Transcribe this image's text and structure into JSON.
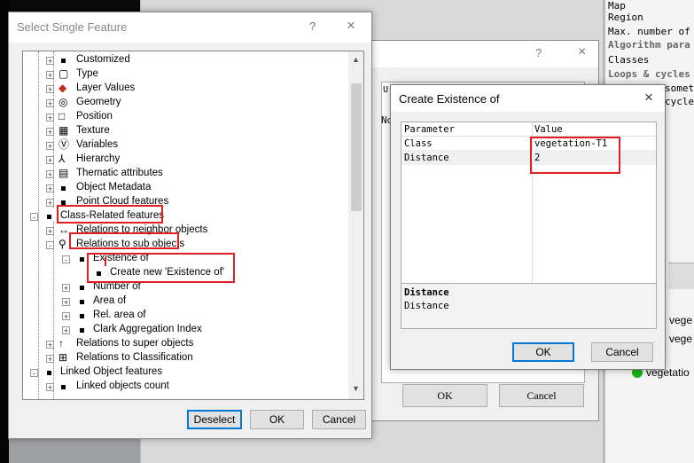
{
  "right_panel": {
    "lines": [
      "Map",
      "Region",
      "Max. number of o",
      "Algorithm para",
      "Classes",
      "Loops & cycles",
      "someti",
      "cycles"
    ],
    "legend": [
      "vege",
      "vege",
      "vegetatio"
    ]
  },
  "bg_window": {
    "help": "?",
    "close": "×",
    "grid_header": "U",
    "grid_cell": "No",
    "ok": "OK",
    "cancel": "Cancel"
  },
  "select_feature": {
    "title": "Select Single Feature",
    "help": "?",
    "close": "×",
    "tree": [
      {
        "label": "Customized",
        "icon": "bullet"
      },
      {
        "label": "Type",
        "icon": "type-icon"
      },
      {
        "label": "Layer Values",
        "icon": "layer-values-icon"
      },
      {
        "label": "Geometry",
        "icon": "geometry-icon"
      },
      {
        "label": "Position",
        "icon": "position-icon"
      },
      {
        "label": "Texture",
        "icon": "texture-icon"
      },
      {
        "label": "Variables",
        "icon": "variables-icon"
      },
      {
        "label": "Hierarchy",
        "icon": "hierarchy-icon"
      },
      {
        "label": "Thematic attributes",
        "icon": "thematic-icon"
      },
      {
        "label": "Object Metadata",
        "icon": "bullet"
      },
      {
        "label": "Point Cloud features",
        "icon": "bullet"
      },
      {
        "label": "Class-Related features",
        "icon": "bullet"
      },
      {
        "label": "Relations to neighbor objects",
        "icon": "neighbor-icon"
      },
      {
        "label": "Relations to sub objects",
        "icon": "sub-objects-icon"
      },
      {
        "label": "Existence of",
        "icon": "bullet"
      },
      {
        "label": "Create new 'Existence of'",
        "icon": "bullet"
      },
      {
        "label": "Number of",
        "icon": "bullet"
      },
      {
        "label": "Area of",
        "icon": "bullet"
      },
      {
        "label": "Rel. area of",
        "icon": "bullet"
      },
      {
        "label": "Clark Aggregation Index",
        "icon": "bullet"
      },
      {
        "label": "Relations to super objects",
        "icon": "super-objects-icon"
      },
      {
        "label": "Relations to Classification",
        "icon": "classification-icon"
      },
      {
        "label": "Linked Object features",
        "icon": "bullet"
      },
      {
        "label": "Linked objects count",
        "icon": "bullet"
      }
    ],
    "deselect": "Deselect",
    "ok": "OK",
    "cancel": "Cancel"
  },
  "create_existence": {
    "title": "Create Existence of",
    "close": "×",
    "headers": [
      "Parameter",
      "Value"
    ],
    "rows": [
      {
        "param": "Class",
        "value": "vegetation-T1"
      },
      {
        "param": "Distance",
        "value": "2"
      }
    ],
    "desc_title": "Distance",
    "desc_text": "Distance",
    "ok": "OK",
    "cancel": "Cancel"
  }
}
